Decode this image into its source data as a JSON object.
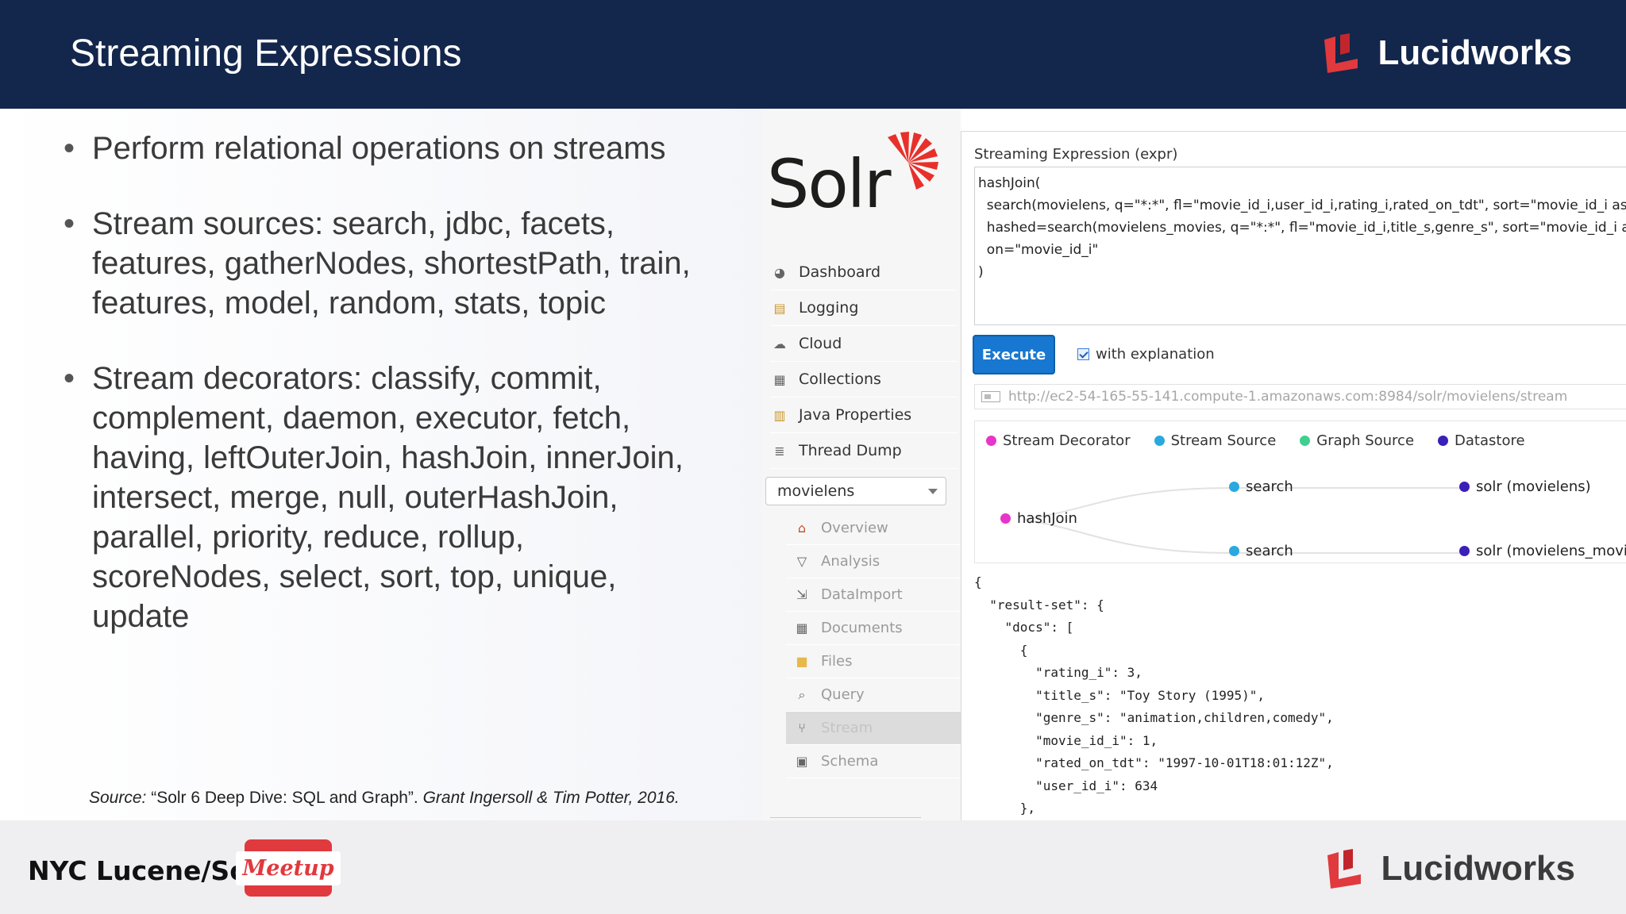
{
  "header": {
    "title": "Streaming Expressions",
    "brand": "Lucidworks"
  },
  "bullets": [
    "Perform relational operations on streams",
    "Stream sources: search, jdbc, facets, features, gatherNodes, shortestPath, train, features, model, random, stats, topic",
    "Stream decorators: classify, commit, complement, daemon, executor, fetch, having, leftOuterJoin, hashJoin, innerJoin, intersect, merge, null, outerHashJoin, parallel, priority, reduce, rollup, scoreNodes, select, sort, top, unique, update"
  ],
  "source": {
    "prefix": "Source:",
    "title": " “Solr 6 Deep Dive: SQL and Graph”. ",
    "authors": "Grant Ingersoll & Tim Potter, 2016."
  },
  "footer": {
    "meetup_label": "NYC Lucene/Solr",
    "meetup_badge": "Meetup",
    "brand": "Lucidworks"
  },
  "colors": {
    "header_bg": "#13264b",
    "brand_red": "#e0393e",
    "solr_orange": "#e8302a",
    "execute_blue": "#1877d0",
    "decorator": "#e735c9",
    "source": "#29a9de",
    "graph_source": "#3fd08f",
    "datastore": "#3a1fb8"
  },
  "solr": {
    "logo": "Solr",
    "nav": [
      {
        "label": "Dashboard",
        "icon": "dashboard-icon"
      },
      {
        "label": "Logging",
        "icon": "logging-icon"
      },
      {
        "label": "Cloud",
        "icon": "cloud-icon"
      },
      {
        "label": "Collections",
        "icon": "collections-icon"
      },
      {
        "label": "Java Properties",
        "icon": "java-icon"
      },
      {
        "label": "Thread Dump",
        "icon": "thread-dump-icon"
      }
    ],
    "core_selector": "movielens",
    "subnav": [
      {
        "label": "Overview",
        "icon": "home-icon"
      },
      {
        "label": "Analysis",
        "icon": "funnel-icon"
      },
      {
        "label": "DataImport",
        "icon": "import-icon"
      },
      {
        "label": "Documents",
        "icon": "documents-icon"
      },
      {
        "label": "Files",
        "icon": "folder-icon"
      },
      {
        "label": "Query",
        "icon": "magnifier-icon"
      },
      {
        "label": "Stream",
        "icon": "stream-icon"
      },
      {
        "label": "Schema",
        "icon": "schema-icon"
      }
    ],
    "expr_label": "Streaming Expression (expr)",
    "expr_text": "hashJoin(\n  search(movielens, q=\"*:*\", fl=\"movie_id_i,user_id_i,rating_i,rated_on_tdt\", sort=\"movie_id_i asc\"),\n  hashed=search(movielens_movies, q=\"*:*\", fl=\"movie_id_i,title_s,genre_s\", sort=\"movie_id_i asc\"),\n  on=\"movie_id_i\"\n)",
    "execute_label": "Execute",
    "explanation_label": "with explanation",
    "url": "http://ec2-54-165-55-141.compute-1.amazonaws.com:8984/solr/movielens/stream",
    "legend": [
      {
        "label": "Stream Decorator",
        "color": "#e735c9"
      },
      {
        "label": "Stream Source",
        "color": "#29a9de"
      },
      {
        "label": "Graph Source",
        "color": "#3fd08f"
      },
      {
        "label": "Datastore",
        "color": "#3a1fb8"
      }
    ],
    "graph": {
      "root": "hashJoin",
      "search_top": "search",
      "search_bottom": "search",
      "store_top": "solr (movielens)",
      "store_bottom": "solr (movielens_movies)"
    },
    "json_output": "{\n  \"result-set\": {\n    \"docs\": [\n      {\n        \"rating_i\": 3,\n        \"title_s\": \"Toy Story (1995)\",\n        \"genre_s\": \"animation,children,comedy\",\n        \"movie_id_i\": 1,\n        \"rated_on_tdt\": \"1997-10-01T18:01:12Z\",\n        \"user_id_i\": 634\n      },"
  }
}
